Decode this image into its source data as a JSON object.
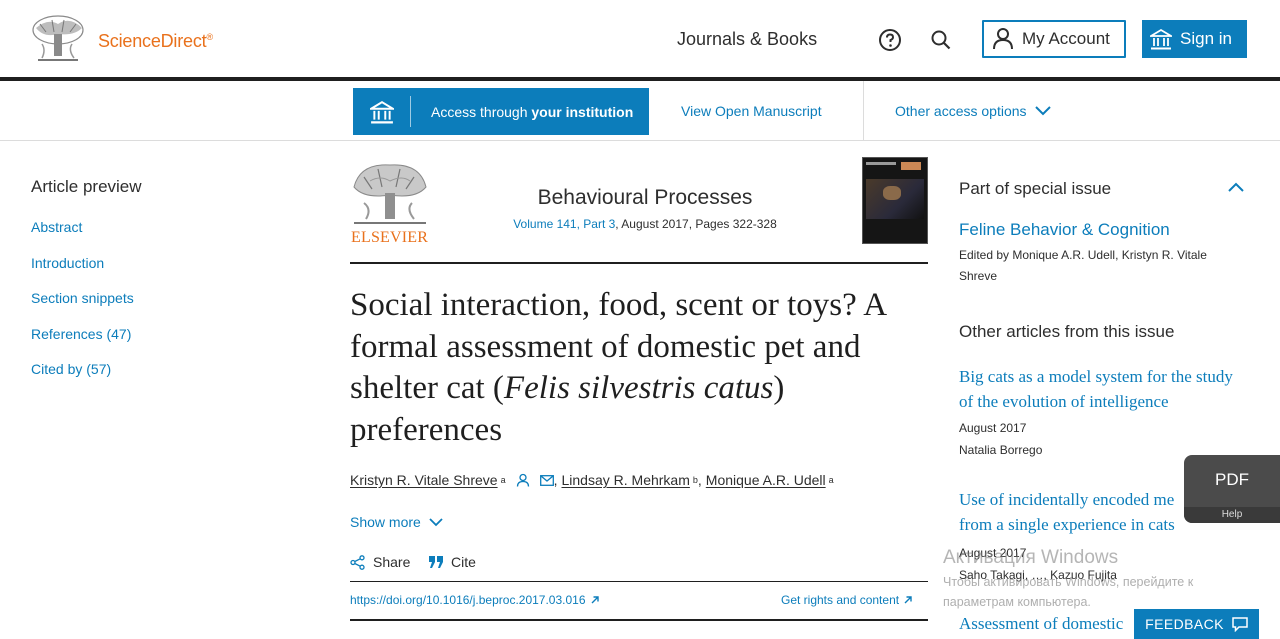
{
  "header": {
    "brand": "ScienceDirect",
    "brand_mark": "®",
    "nav_journals": "Journals & Books",
    "my_account": "My Account",
    "sign_in": "Sign in",
    "icons": [
      "elsevier-tree-icon",
      "help-icon",
      "search-icon",
      "user-icon",
      "institution-icon"
    ]
  },
  "access_bar": {
    "institution_prefix": "Access through ",
    "institution_bold": "your institution",
    "view_manuscript": "View Open Manuscript",
    "other_access": "Other access options"
  },
  "sidebar": {
    "title": "Article preview",
    "items": [
      {
        "label": "Abstract"
      },
      {
        "label": "Introduction"
      },
      {
        "label": "Section snippets"
      },
      {
        "label": "References (47)"
      },
      {
        "label": "Cited by (57)"
      }
    ]
  },
  "article": {
    "publisher": "ELSEVIER",
    "journal": "Behavioural Processes",
    "volume_link": "Volume 141, Part 3",
    "volume_rest": ", August 2017, Pages 322-328",
    "title_part1": "Social interaction, food, scent or toys? A formal assessment of domestic pet and shelter cat (",
    "title_italic": "Felis silvestris catus",
    "title_part2": ") preferences",
    "authors": [
      {
        "name": "Kristyn R. Vitale Shreve",
        "sup": "a"
      },
      {
        "name": "Lindsay R. Mehrkam",
        "sup": "b"
      },
      {
        "name": "Monique A.R. Udell",
        "sup": "a"
      }
    ],
    "author_sep1": ",",
    "author_sep2": ",",
    "show_more": "Show more",
    "share": "Share",
    "cite": "Cite",
    "doi": "https://doi.org/10.1016/j.beproc.2017.03.016",
    "rights": "Get rights and content"
  },
  "right_panel": {
    "special_title": "Part of special issue",
    "special_link": "Feline Behavior & Cognition",
    "special_editors": "Edited by Monique A.R. Udell, Kristyn R. Vitale Shreve",
    "other_title": "Other articles from this issue",
    "related": [
      {
        "title": "Big cats as a model system for the study of the evolution of intelligence",
        "date": "August 2017",
        "author": "Natalia Borrego"
      },
      {
        "title": "Use of incidentally encoded me from a single experience in cats",
        "date": "August 2017",
        "author": "Saho Takagi, …, Kazuo Fujita"
      },
      {
        "title": "Assessment of domestic"
      }
    ]
  },
  "pdf_widget": {
    "label": "PDF",
    "help": "Help"
  },
  "windows_overlay": {
    "title": "Активация Windows",
    "subtitle": "Чтобы активировать Windows, перейдите к параметрам компьютера."
  },
  "feedback": {
    "label": "FEEDBACK"
  },
  "colors": {
    "brand_orange": "#e9711c",
    "link_blue": "#0c7dbb",
    "text": "#2e2e2e",
    "rule": "#1f1f1f"
  }
}
